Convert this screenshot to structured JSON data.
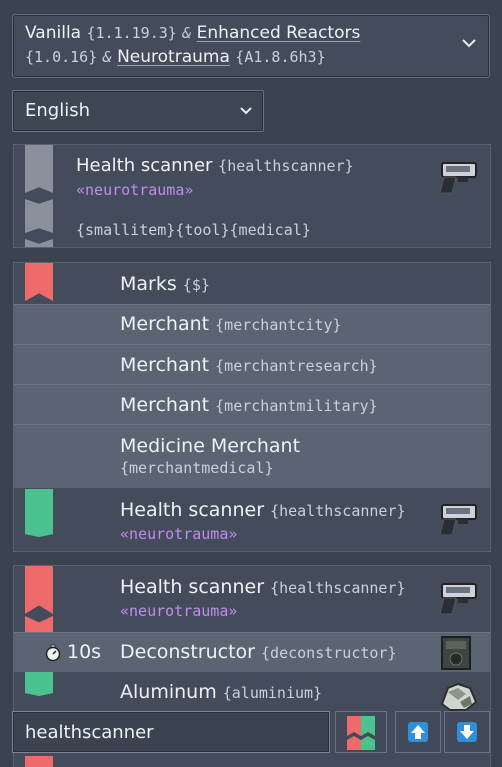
{
  "mods": {
    "line1": [
      {
        "name": "Vanilla",
        "version": "{1.1.19.3}",
        "sep": "&"
      },
      {
        "name": "Enhanced Reactors",
        "version": "",
        "sep": ""
      }
    ],
    "enhanced_version": "{1.0.16}",
    "amp2": "&",
    "neuro_name": "Neurotrauma",
    "neuro_version": "{A1.8.6h3}"
  },
  "language": {
    "selected": "English"
  },
  "item_card": {
    "name": "Health scanner",
    "id": "{healthscanner}",
    "package": "«neurotrauma»",
    "tags": "{smallitem}{tool}{medical}"
  },
  "sell_card": {
    "marks_label": "Marks",
    "marks_id": "{$}",
    "merchants": [
      {
        "name": "Merchant",
        "id": "{merchantcity}"
      },
      {
        "name": "Merchant",
        "id": "{merchantresearch}"
      },
      {
        "name": "Merchant",
        "id": "{merchantmilitary}"
      }
    ],
    "medicine_name": "Medicine Merchant",
    "medicine_id": "{merchantmedical}",
    "result_name": "Health scanner",
    "result_id": "{healthscanner}",
    "result_package": "«neurotrauma»"
  },
  "decon_card": {
    "item_name": "Health scanner",
    "item_id": "{healthscanner}",
    "item_package": "«neurotrauma»",
    "time": "10s",
    "decon_name": "Deconstructor",
    "decon_id": "{deconstructor}",
    "out_name": "Aluminum",
    "out_id": "{aluminium}"
  },
  "search": {
    "value": "healthscanner"
  },
  "colors": {
    "red": "#ef6a6a",
    "green": "#4cc38f",
    "gray": "#8a909c",
    "accent": "#2f8fd8"
  }
}
